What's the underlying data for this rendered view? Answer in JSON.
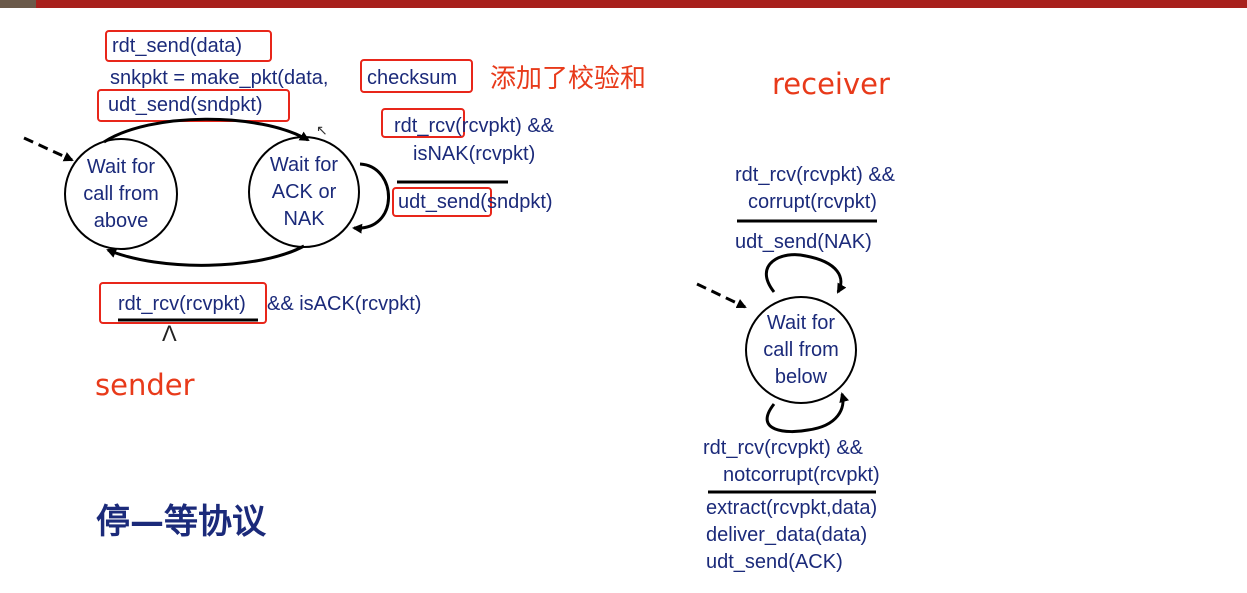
{
  "sender": {
    "label": "sender",
    "action_lines": {
      "rdt_send": "rdt_send(data)",
      "make_pkt_prefix": "snkpkt = make_pkt(data,",
      "checksum": "checksum",
      "udt_send": "udt_send(sndpkt)"
    },
    "annotation": "添加了校验和",
    "state_wait_above": [
      "Wait for",
      "call from",
      "above"
    ],
    "state_wait_ack": [
      "Wait for",
      "ACK or",
      "NAK"
    ],
    "nak_loop": {
      "rdt_rcv_part": "rdt_rcv",
      "rdt_rcv_rest": "(rcvpkt) &&",
      "condition2": "isNAK(rcvpkt)",
      "action_part": "udt_send",
      "action_rest": "(sndpkt)"
    },
    "ack_transition": {
      "rdt_rcv": "rdt_rcv(rcvpkt)",
      "rest": " && isACK(rcvpkt)",
      "lambda": "Λ"
    }
  },
  "receiver": {
    "label": "receiver",
    "state_wait_below": [
      "Wait for",
      "call from",
      "below"
    ],
    "corrupt_loop": {
      "condition1": "rdt_rcv(rcvpkt) &&",
      "condition2": "corrupt(rcvpkt)",
      "action": "udt_send(NAK)"
    },
    "notcorrupt_loop": {
      "condition1": "rdt_rcv(rcvpkt) &&",
      "condition2": "notcorrupt(rcvpkt)",
      "actions": [
        "extract(rcvpkt,data)",
        "deliver_data(data)",
        "udt_send(ACK)"
      ]
    }
  },
  "title": "停—等协议",
  "colors": {
    "text": "#1b2a7a",
    "highlight_box": "#e8261a",
    "handwriting": "#e83a1a",
    "topbar": "#a8201c"
  }
}
